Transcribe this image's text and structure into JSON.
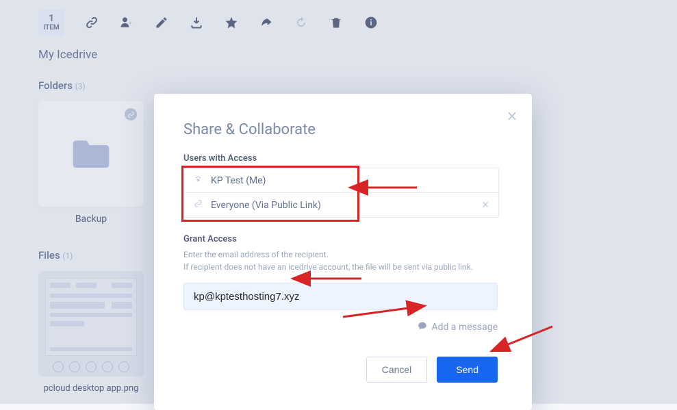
{
  "toolbar": {
    "item_count_num": "1",
    "item_count_label": "ITEM"
  },
  "breadcrumb": "My Icedrive",
  "folders": {
    "label": "Folders",
    "count": "(3)",
    "items": [
      {
        "name": "Backup"
      }
    ]
  },
  "files": {
    "label": "Files",
    "count": "(1)",
    "items": [
      {
        "name": "pcloud desktop app.png"
      }
    ]
  },
  "modal": {
    "title": "Share & Collaborate",
    "users_label": "Users with Access",
    "users": [
      {
        "label": "KP Test (Me)"
      },
      {
        "label": "Everyone (Via Public Link)"
      }
    ],
    "grant_label": "Grant Access",
    "grant_desc1": "Enter the email address of the recipient.",
    "grant_desc2": "If recipient does not have an icedrive account, the file will be sent via public link.",
    "email_value": "kp@kptesthosting7.xyz",
    "add_message": "Add a message",
    "cancel": "Cancel",
    "send": "Send"
  }
}
